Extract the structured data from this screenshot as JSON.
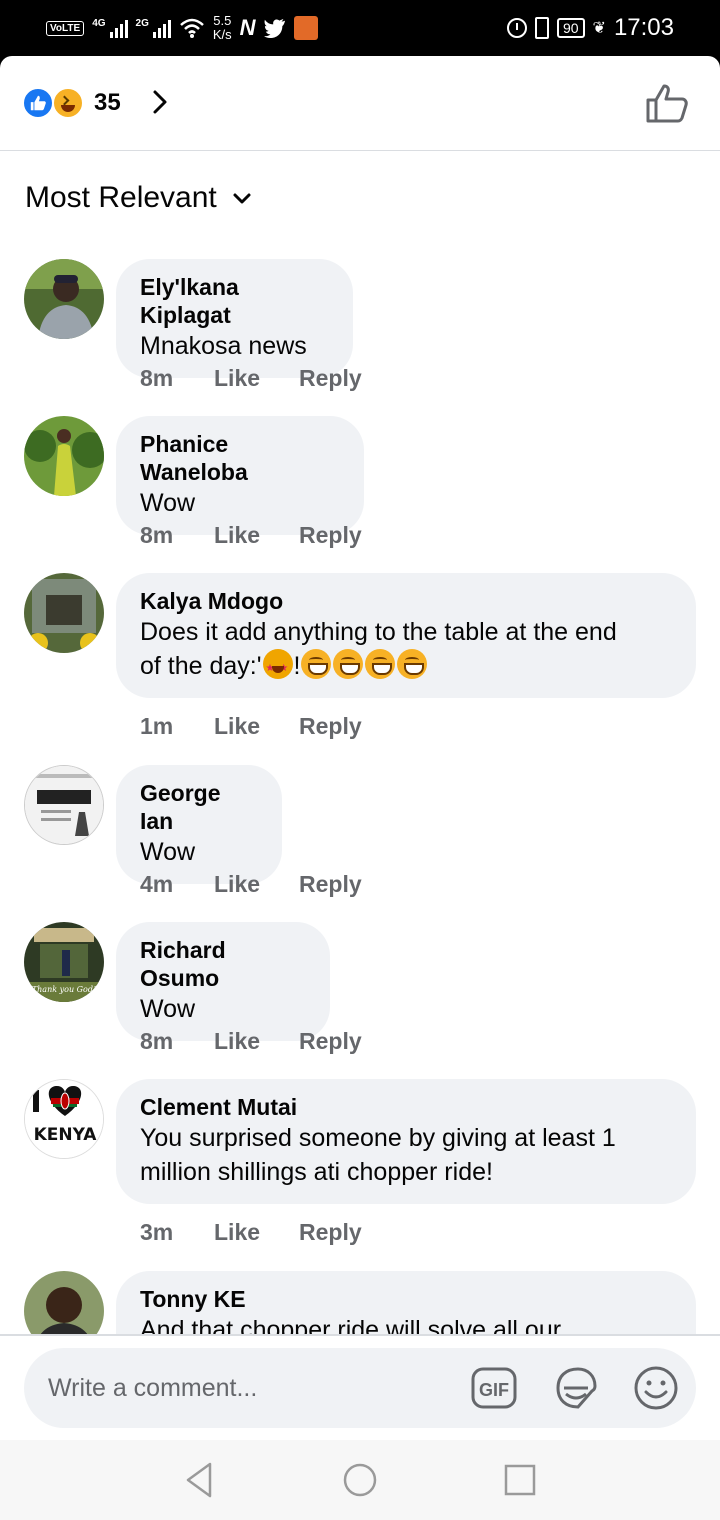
{
  "status_bar": {
    "volte": "VoLTE",
    "net1": "4G",
    "net2": "2G",
    "speed_value": "5.5",
    "speed_unit": "K/s",
    "battery": "90",
    "time": "17:03"
  },
  "header": {
    "reaction_count": "35",
    "reactions": [
      "like-reaction-icon",
      "haha-reaction-icon"
    ]
  },
  "sort": {
    "label": "Most Relevant"
  },
  "comments": [
    {
      "name": "Ely'lkana Kiplagat",
      "text": "Mnakosa news",
      "time": "8m",
      "like": "Like",
      "reply": "Reply",
      "avatar_color": "#5a6b3a"
    },
    {
      "name": "Phanice Waneloba",
      "text": "Wow",
      "time": "8m",
      "like": "Like",
      "reply": "Reply",
      "avatar_color": "#8ab23a"
    },
    {
      "name": "Kalya Mdogo",
      "text_line1": "Does it add anything to the table at the end",
      "text_line2_prefix": "of the day:'",
      "text_line2_mid": "!",
      "time": "1m",
      "like": "Like",
      "reply": "Reply",
      "avatar_color": "#4a6a3a"
    },
    {
      "name": "George Ian",
      "text": "Wow",
      "time": "4m",
      "like": "Like",
      "reply": "Reply",
      "avatar_color": "#dddddd"
    },
    {
      "name": "Richard Osumo",
      "text": "Wow",
      "time": "8m",
      "like": "Like",
      "reply": "Reply",
      "avatar_color": "#3b4a2c",
      "avatar_caption": "Thank you God!"
    },
    {
      "name": "Clement Mutai",
      "text_line1": "You surprised someone by giving  at least 1",
      "text_line2": "million shillings ati chopper ride!",
      "time": "3m",
      "like": "Like",
      "reply": "Reply",
      "avatar_label": "KENYA"
    },
    {
      "name": "Tonny KE",
      "text": "And that chopper ride will solve all our",
      "avatar_color": "#6b7b5a"
    }
  ],
  "composer": {
    "placeholder": "Write a comment...",
    "gif_label": "GIF"
  },
  "colors": {
    "facebook_blue": "#1877f2",
    "bubble_bg": "#f0f2f5",
    "meta_gray": "#65676b"
  }
}
